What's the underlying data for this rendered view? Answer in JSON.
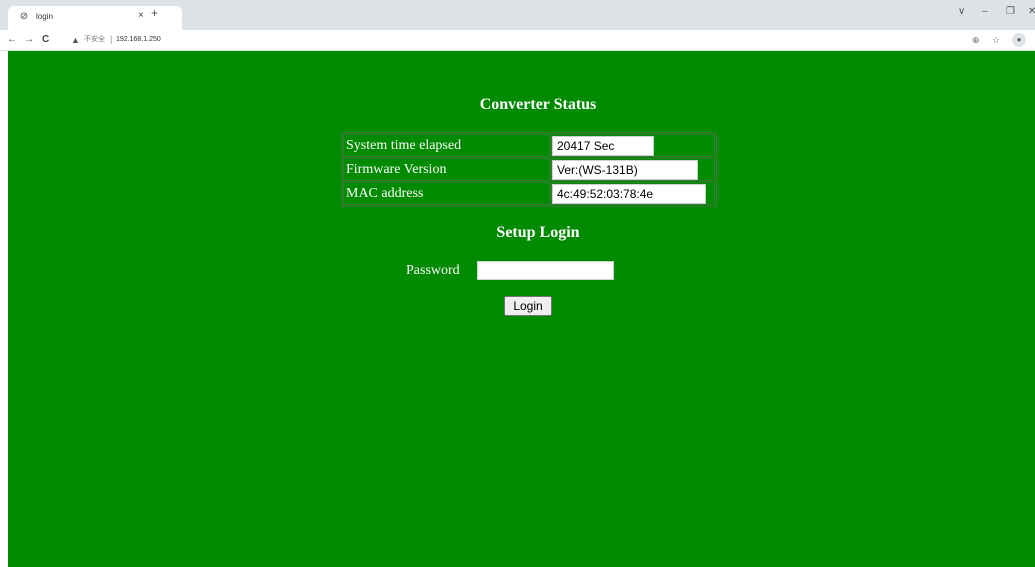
{
  "browser": {
    "tab_title": "login",
    "new_tab": "+",
    "tab_close": "×",
    "back": "←",
    "forward": "→",
    "reload": "C",
    "security_label": "不安全",
    "url": "192.168.1.250",
    "window_controls": {
      "dropdown": "∨",
      "minimize": "–",
      "restore": "❐",
      "close": "✕"
    }
  },
  "page": {
    "status_heading": "Converter Status",
    "status_rows": [
      {
        "label": "System time elapsed",
        "value": "20417 Sec"
      },
      {
        "label": "Firmware Version",
        "value": "Ver:(WS-131B)"
      },
      {
        "label": "MAC address",
        "value": "4c:49:52:03:78:4e"
      }
    ],
    "login_heading": "Setup Login",
    "password_label": "Password",
    "password_value": "",
    "login_button": "Login"
  },
  "colors": {
    "page_background": "#008a00",
    "text": "#ffffff",
    "tab_strip": "#dee1e6"
  }
}
